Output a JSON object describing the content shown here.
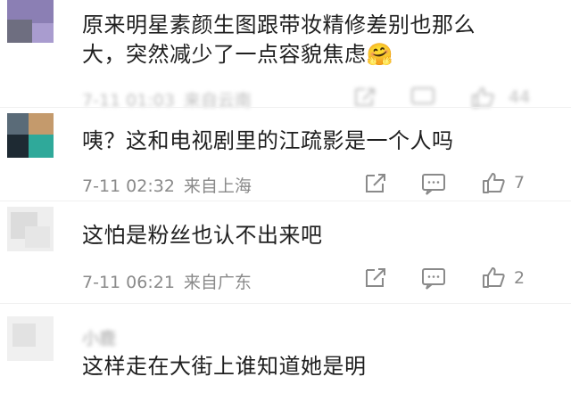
{
  "comments": [
    {
      "text_line1": "原来明星素颜生图跟带妆精修差别也那么",
      "text_line2": "大，突然减少了一点容貌焦虑",
      "emoji": "🤗",
      "date": "7-11 01:03",
      "location": "来自云南",
      "likes": "44"
    },
    {
      "text_line1": "咦？这和电视剧里的江疏影是一个人吗",
      "date": "7-11 02:32",
      "location": "来自上海",
      "likes": "7"
    },
    {
      "text_line1": "这怕是粉丝也认不出来吧",
      "date": "7-11 06:21",
      "location": "来自广东",
      "likes": "2"
    },
    {
      "username": "小鹿",
      "text_line1": "这样走在大街上谁知道她是明"
    }
  ],
  "icons": {
    "share": "share-icon",
    "comment": "comment-icon",
    "like": "thumbs-up-icon"
  },
  "colors": {
    "text": "#1f1f1f",
    "meta": "#8a8a8a",
    "icon": "#8a8a8a"
  }
}
